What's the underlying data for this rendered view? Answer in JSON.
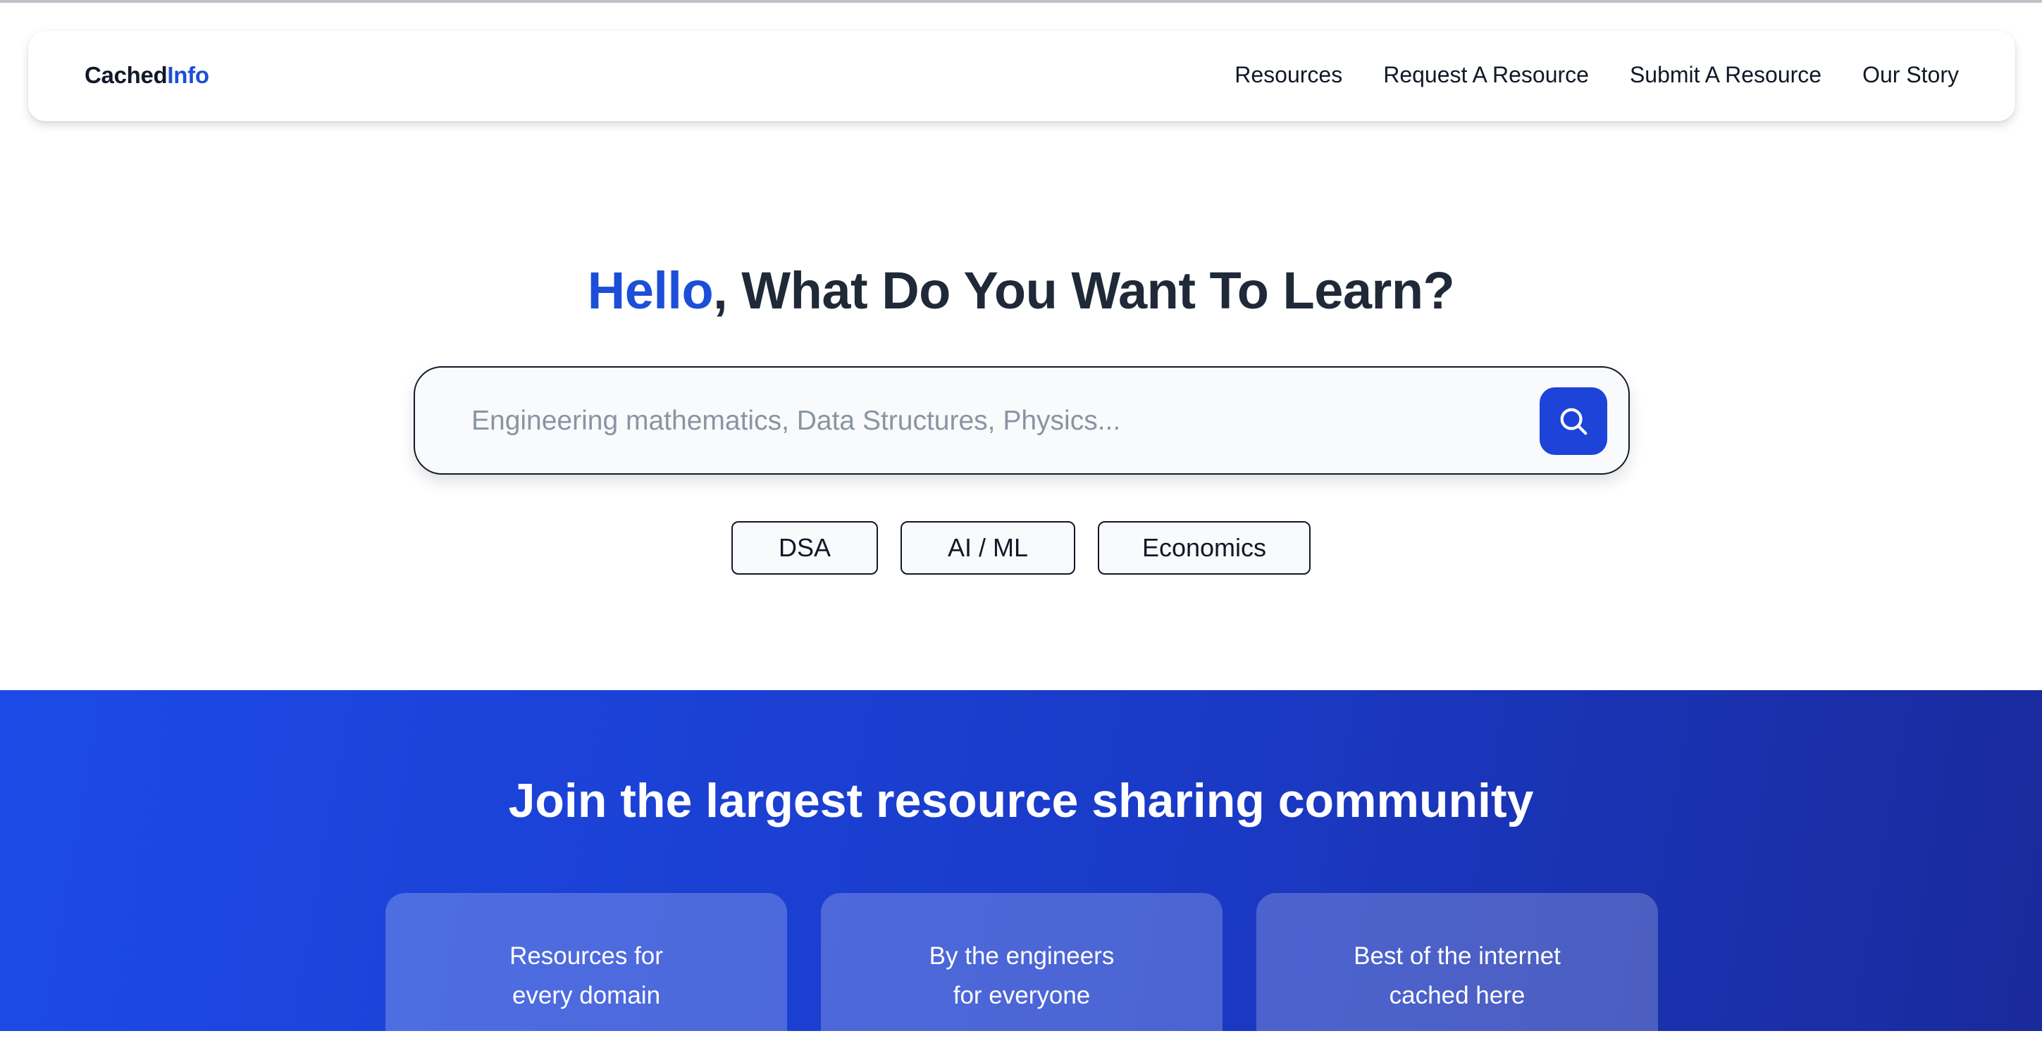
{
  "colors": {
    "accent": "#1d4ed8",
    "button": "#1d43d8",
    "banner_start": "#1d4ae6",
    "banner_end": "#1a2a9c"
  },
  "brand": {
    "part1": "Cached",
    "part2": "Info"
  },
  "nav": {
    "items": [
      {
        "label": "Resources"
      },
      {
        "label": "Request A Resource"
      },
      {
        "label": "Submit A Resource"
      },
      {
        "label": "Our Story"
      }
    ]
  },
  "hero": {
    "title_highlight": "Hello",
    "title_rest": ", What Do You Want To Learn?",
    "search": {
      "placeholder": "Engineering mathematics, Data Structures, Physics...",
      "value": "",
      "button_icon": "search-icon"
    },
    "chips": [
      {
        "label": "DSA"
      },
      {
        "label": "AI / ML"
      },
      {
        "label": "Economics"
      }
    ]
  },
  "community": {
    "title": "Join the largest resource sharing community",
    "cards": [
      {
        "line1": "Resources for",
        "line2": "every domain"
      },
      {
        "line1": "By the engineers",
        "line2": "for everyone"
      },
      {
        "line1": "Best of the internet",
        "line2": "cached here"
      }
    ]
  }
}
